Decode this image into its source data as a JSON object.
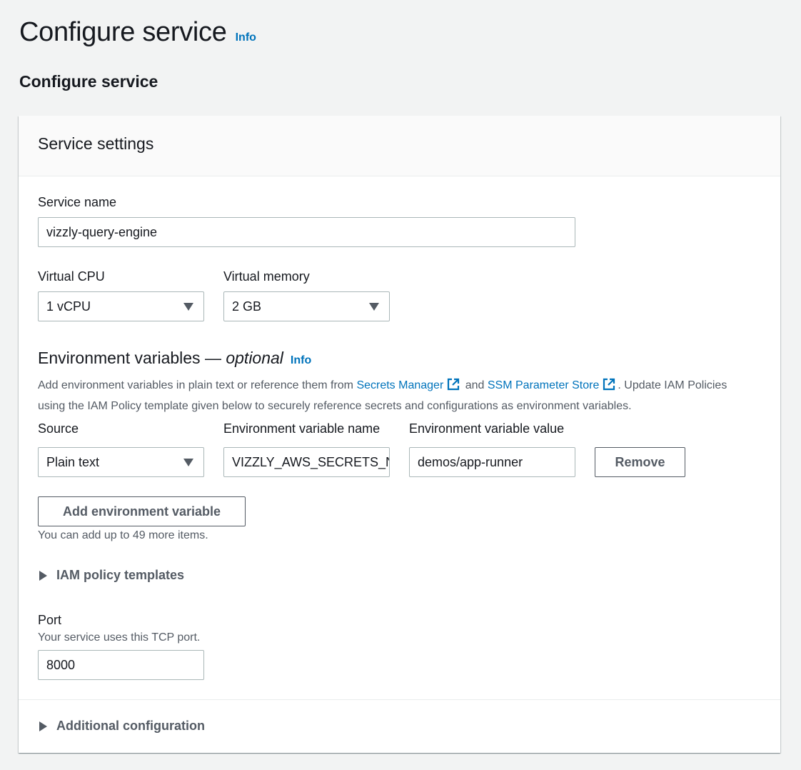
{
  "page": {
    "title": "Configure service",
    "info": "Info"
  },
  "section": {
    "title": "Configure service"
  },
  "panel": {
    "header": "Service settings",
    "service_name": {
      "label": "Service name",
      "value": "vizzly-query-engine"
    },
    "vcpu": {
      "label": "Virtual CPU",
      "value": "1 vCPU"
    },
    "memory": {
      "label": "Virtual memory",
      "value": "2 GB"
    },
    "env": {
      "title": "Environment variables — ",
      "title_optional": "optional",
      "info": "Info",
      "desc_part1": "Add environment variables in plain text or reference them from ",
      "link1": "Secrets Manager",
      "desc_and": " and ",
      "link2": "SSM Parameter Store",
      "desc_part2": ". Update IAM Policies using the IAM Policy template given below to securely reference secrets and configurations as environment variables.",
      "col_source": "Source",
      "col_name": "Environment variable name",
      "col_value": "Environment variable value",
      "row": {
        "source": "Plain text",
        "name": "VIZZLY_AWS_SECRETS_NAME",
        "value": "demos/app-runner"
      },
      "remove_label": "Remove",
      "add_label": "Add environment variable",
      "limit_note": "You can add up to 49 more items."
    },
    "iam_templates": "IAM policy templates",
    "port": {
      "label": "Port",
      "hint": "Your service uses this TCP port.",
      "value": "8000"
    },
    "additional": "Additional configuration"
  },
  "colors": {
    "link": "#0073bb",
    "border": "#aab7b8",
    "text_secondary": "#545b64"
  }
}
